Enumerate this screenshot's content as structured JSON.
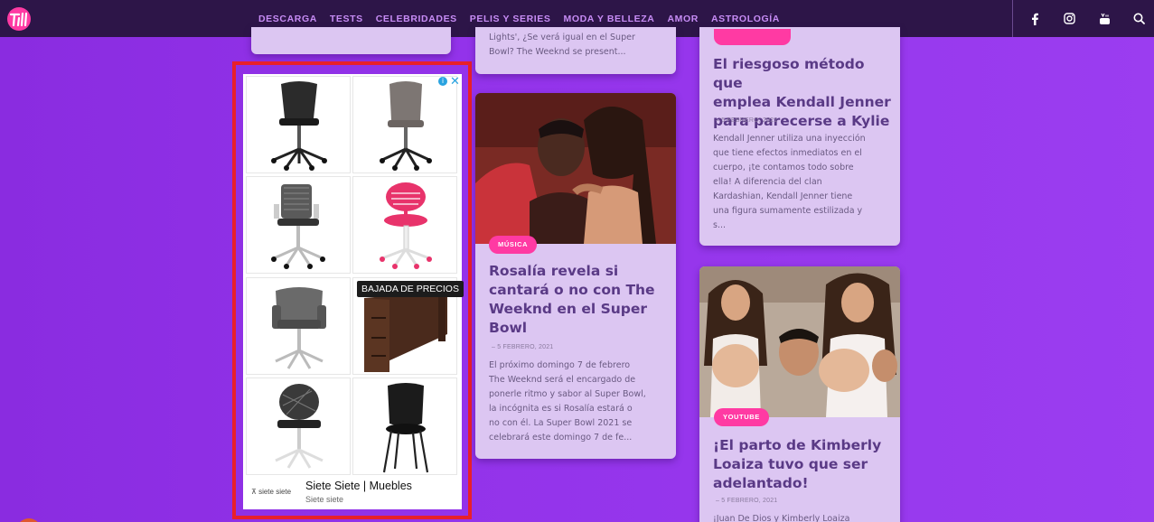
{
  "nav": {
    "links": [
      "DESCARGA",
      "TESTS",
      "CELEBRIDADES",
      "PELIS Y SERIES",
      "MODA Y BELLEZA",
      "AMOR",
      "ASTROLOGÍA"
    ],
    "social": [
      "facebook-icon",
      "instagram-icon",
      "youtube-icon",
      "search-icon"
    ]
  },
  "ad": {
    "price_tag": "BAJADA DE PRECIOS",
    "brand_logo": "siete siete",
    "title": "Siete Siete | Muebles",
    "subtitle": "Siete siete",
    "close": "✕",
    "info": "i"
  },
  "cards": {
    "top_snippet": {
      "excerpt_lines": [
        "Lights', ¿Se verá igual en el Super",
        "Bowl? The Weeknd se present..."
      ]
    },
    "rosalia": {
      "badge": "MÚSICA",
      "title_lines": [
        "Rosalía revela si",
        "cantará o no con The",
        "Weeknd en el Super",
        "Bowl"
      ],
      "date": "– 5 FEBRERO, 2021",
      "excerpt_lines": [
        "El próximo domingo 7 de febrero",
        "The Weeknd será el encargado de",
        "ponerle ritmo y sabor al Super Bowl,",
        "la incógnita es si Rosalía estará o",
        "no con él. La Super Bowl 2021 se",
        "celebrará este domingo 7 de fe..."
      ]
    },
    "kendall": {
      "title_lines": [
        "El riesgoso método que",
        "emplea Kendall Jenner",
        "para parecerse a Kylie"
      ],
      "date": "– 5 FEBRERO, 2021",
      "excerpt_lines": [
        "Kendall Jenner utiliza una inyección",
        "que tiene efectos inmediatos en el",
        "cuerpo, ¡te contamos todo sobre",
        "ella! A diferencia del clan",
        "Kardashian, Kendall Jenner tiene",
        "una figura sumamente estilizada y",
        "s..."
      ]
    },
    "kimberly": {
      "badge": "YOUTUBE",
      "title_lines": [
        "¡El parto de Kimberly",
        "Loaiza tuvo que ser",
        "adelantado!"
      ],
      "date": "– 5 FEBRERO, 2021",
      "excerpt_lines": [
        "¡Juan De Dios y Kimberly Loaiza"
      ]
    }
  },
  "colors": {
    "nav_bg": "#2d1548",
    "nav_link": "#c78cf5",
    "badge": "#ff3aa3",
    "card_bg": "#dcc6f2",
    "ad_outline": "#e8202a"
  }
}
